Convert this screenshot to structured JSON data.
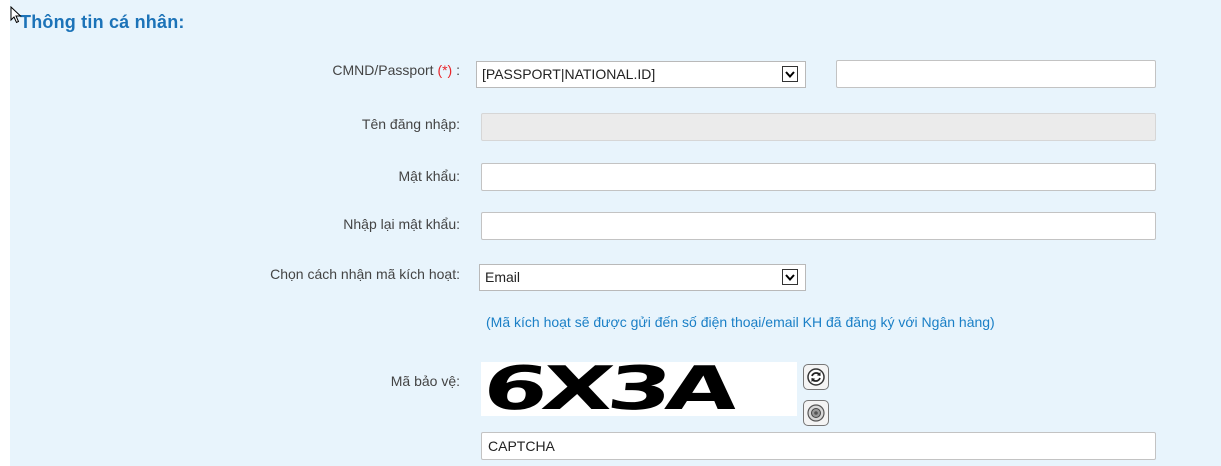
{
  "section_title": "Thông tin cá nhân:",
  "fields": {
    "id_type": {
      "label": "CMND/Passport",
      "required_mark": "(*)",
      "colon": ":",
      "selected": "[PASSPORT|NATIONAL.ID]",
      "number_value": ""
    },
    "username": {
      "label": "Tên đăng nhập:",
      "value": ""
    },
    "password": {
      "label": "Mật khẩu:",
      "value": ""
    },
    "password_confirm": {
      "label": "Nhập lại mật khẩu:",
      "value": ""
    },
    "activation_method": {
      "label": "Chọn cách nhận mã kích hoạt:",
      "selected": "Email",
      "hint": "(Mã kích hoạt sẽ được gửi đến số điện thoại/email KH đã đăng ký với Ngân hàng)"
    },
    "captcha": {
      "label": "Mã bảo vệ:",
      "image_text": "6X3A",
      "input_value": "CAPTCHA"
    }
  },
  "icons": {
    "cursor": "mouse-pointer-icon",
    "dropdown": "chevron-down-icon",
    "refresh": "refresh-icon",
    "audio": "speaker-icon"
  },
  "colors": {
    "panel_background": "#e8f4fc",
    "title": "#1c73b8",
    "required": "#e8262b",
    "hint": "#1a7fc6"
  }
}
